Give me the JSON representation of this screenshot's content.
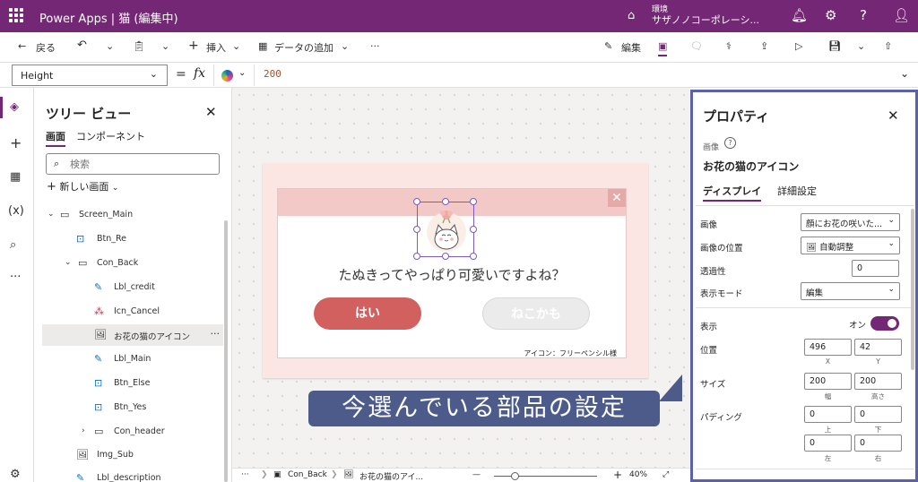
{
  "topbar": {
    "app_title": "Power Apps | 猫 (編集中)",
    "env_label": "環境",
    "env_name": "サザノノコーポレーシ..."
  },
  "cmdbar": {
    "back": "戻る",
    "insert": "挿入",
    "add_data": "データの追加",
    "more": "···",
    "edit": "編集"
  },
  "formula": {
    "property": "Height",
    "eq": "=",
    "fx": "fx",
    "value": "200"
  },
  "tree": {
    "title": "ツリー ビュー",
    "tab_screens": "画面",
    "tab_components": "コンポーネント",
    "search_placeholder": "検索",
    "new_screen": "新しい画面",
    "nodes": [
      {
        "label": "Screen_Main"
      },
      {
        "label": "Btn_Re"
      },
      {
        "label": "Con_Back"
      },
      {
        "label": "Lbl_credit"
      },
      {
        "label": "Icn_Cancel"
      },
      {
        "label": "お花の猫のアイコン"
      },
      {
        "label": "Lbl_Main"
      },
      {
        "label": "Btn_Else"
      },
      {
        "label": "Btn_Yes"
      },
      {
        "label": "Con_header"
      },
      {
        "label": "Img_Sub"
      },
      {
        "label": "Lbl_description"
      }
    ]
  },
  "canvas": {
    "question": "たぬきってやっぱり可愛いですよね？",
    "btn_yes": "はい",
    "btn_else": "ねこかも",
    "credit": "アイコン：フリーペンシル様",
    "close_glyph": "✕"
  },
  "canvas_footer": {
    "more": "···",
    "crumb1": "Con_Back",
    "crumb2": "お花の猫のアイ...",
    "zoom_minus": "—",
    "zoom_plus": "+",
    "zoom": "40%"
  },
  "annotation": "今選んでいる部品の設定",
  "props": {
    "title": "プロパティ",
    "control_type": "画像",
    "control_name": "お花の猫のアイコン",
    "tab_display": "ディスプレイ",
    "tab_advanced": "詳細設定",
    "image_label": "画像",
    "image_value": "顔にお花の咲いた...",
    "image_pos_label": "画像の位置",
    "image_pos_value": "自動調整",
    "transparency_label": "透過性",
    "transparency_value": "0",
    "display_mode_label": "表示モード",
    "display_mode_value": "編集",
    "visible_label": "表示",
    "visible_value": "オン",
    "position_label": "位置",
    "pos_x": "496",
    "pos_y": "42",
    "x_label": "X",
    "y_label": "Y",
    "size_label": "サイズ",
    "width": "200",
    "height": "200",
    "width_label": "幅",
    "height_label": "高さ",
    "padding_label": "パディング",
    "pad_top": "0",
    "pad_bottom": "0",
    "pad_left": "0",
    "pad_right": "0",
    "top_label": "上",
    "bottom_label": "下",
    "left_label": "左",
    "right_label": "右"
  },
  "colors": {
    "brand": "#742774",
    "yes_button": "#d2605f",
    "dialog_header": "#f2c9c6",
    "annotation": "#4c5b8a"
  }
}
